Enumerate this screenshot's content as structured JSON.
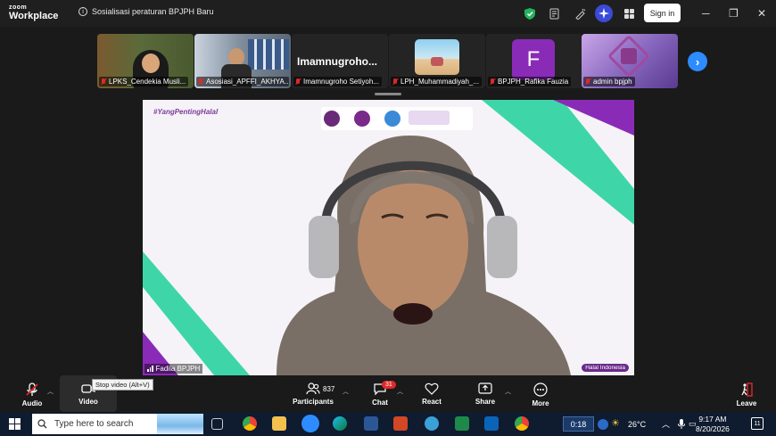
{
  "app": {
    "logo_top": "zoom",
    "logo_bottom": "Workplace"
  },
  "meeting": {
    "title": "Sosialisasi peraturan BPJPH Baru"
  },
  "header": {
    "signin_label": "Sign in",
    "minimize": "─",
    "restore": "❐",
    "close": "✕"
  },
  "participants_strip": [
    {
      "name": "LPKS_Cendekia Musli...",
      "type": "video",
      "bg": "#5a6a3a"
    },
    {
      "name": "Asosiasi_APFFI_AKHYA...",
      "type": "video",
      "bg": "#7d8a9a"
    },
    {
      "name": "Imamnugroho Setiyoh...",
      "type": "name",
      "big_name": "Imamnugroho..."
    },
    {
      "name": "LPH_Muhammadiyah_...",
      "type": "image",
      "bg": "#9fd0ea"
    },
    {
      "name": "BPJPH_Rafika Fauzia",
      "type": "avatar",
      "initial": "F",
      "bg": "#8a2bb8"
    },
    {
      "name": "admin bpjph",
      "type": "image",
      "bg": "#a78ad0"
    }
  ],
  "strip_next": "›",
  "active_speaker": {
    "name": "Fadila BPJPH",
    "banner_tag": "#YangPentingHalal",
    "corner_label": "Halal Indonesia"
  },
  "toolbar": {
    "audio": "Audio",
    "video": "Video",
    "video_tooltip": "Stop video (Alt+V)",
    "participants": "Participants",
    "participants_count": "837",
    "chat": "Chat",
    "chat_badge": "31",
    "react": "React",
    "share": "Share",
    "more": "More",
    "leave": "Leave"
  },
  "taskbar": {
    "search_placeholder": "Type here to search",
    "media_time": "0:18",
    "weather": "26°C",
    "time": "9:17 AM",
    "date": "8/20/2026",
    "notifications": "11"
  }
}
